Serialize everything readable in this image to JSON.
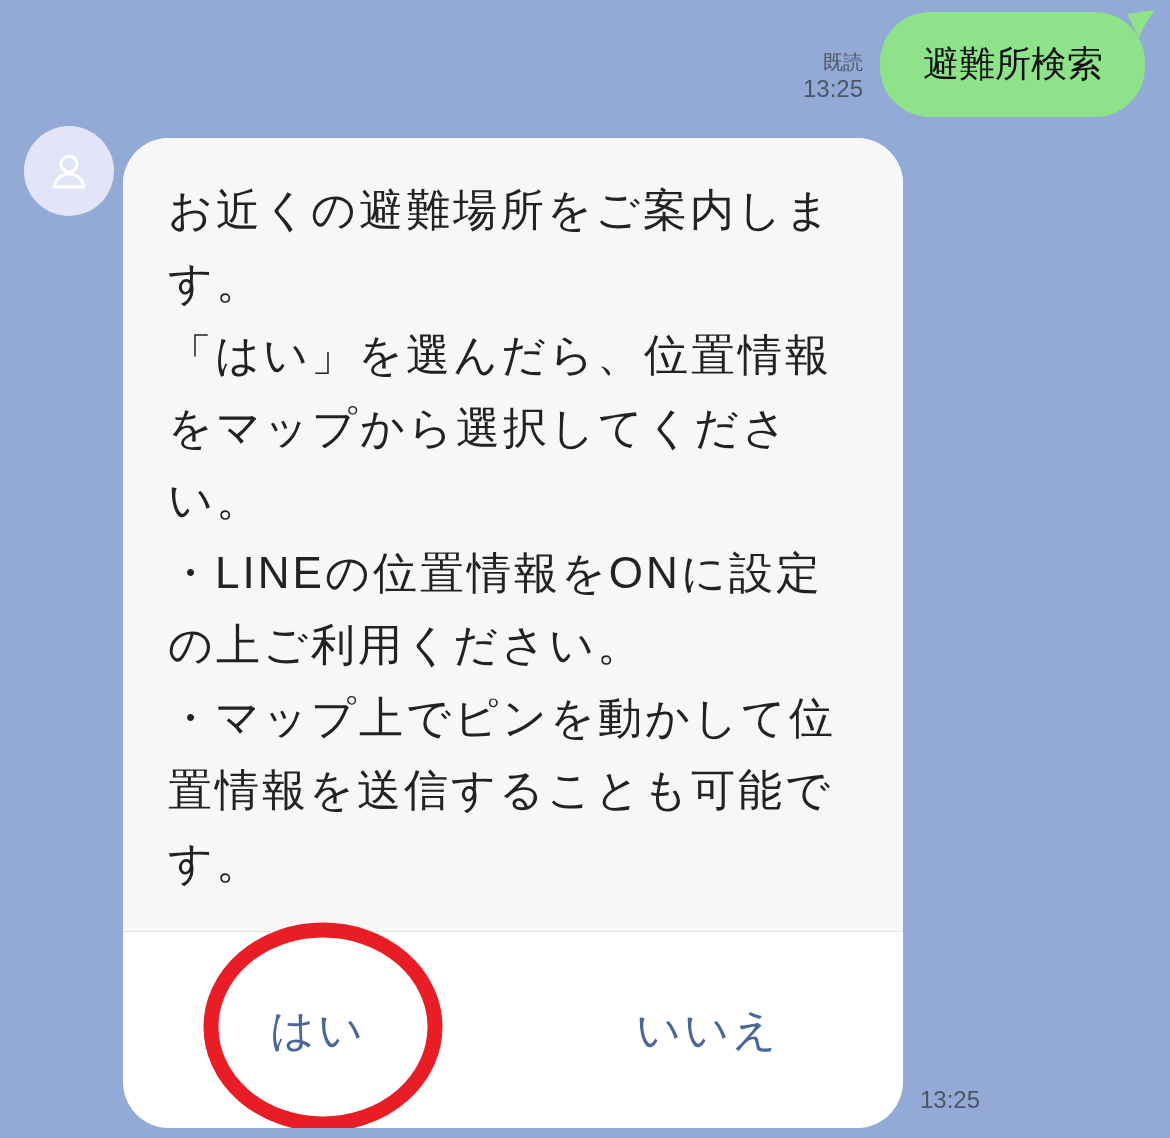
{
  "sent_message": {
    "text": "避難所検索",
    "read_label": "既読",
    "time": "13:25"
  },
  "received_message": {
    "paragraphs": [
      "お近くの避難場所をご案内します。",
      "「はい」を選んだら、位置情報をマップから選択してください。",
      "・LINEの位置情報をONに設定の上ご利用ください。",
      "・マップ上でピンを動かして位置情報を送信することも可能です。"
    ],
    "buttons": [
      {
        "label": "はい",
        "highlighted": true
      },
      {
        "label": "いいえ",
        "highlighted": false
      }
    ],
    "time": "13:25"
  }
}
